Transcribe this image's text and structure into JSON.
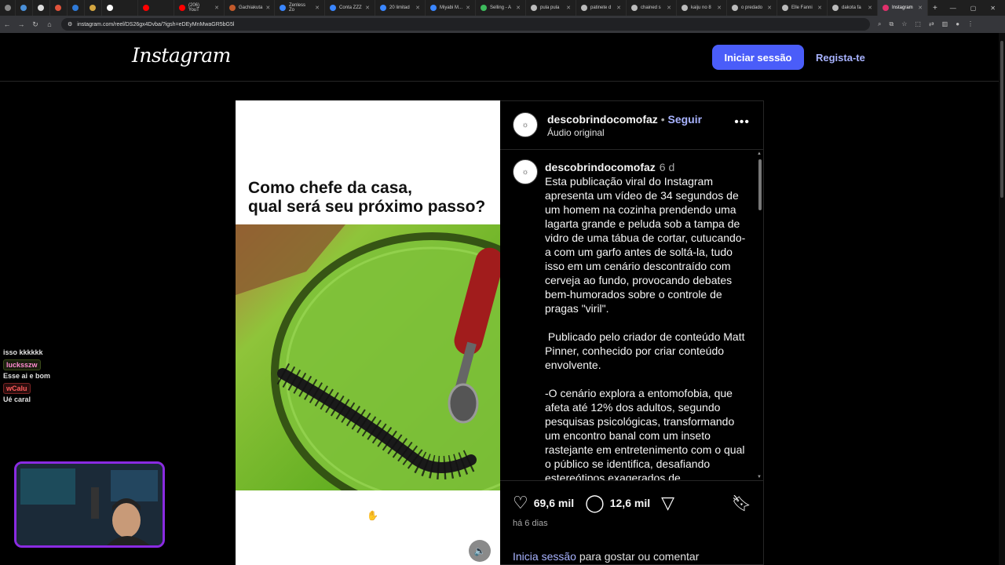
{
  "browser": {
    "tabs": [
      {
        "label": ""
      },
      {
        "label": ""
      },
      {
        "label": ""
      },
      {
        "label": ""
      },
      {
        "label": ""
      },
      {
        "label": ""
      },
      {
        "label": "(206) YouT"
      },
      {
        "label": "Gachiakuta"
      },
      {
        "label": "Zenless Zo"
      },
      {
        "label": "Conta ZZZ"
      },
      {
        "label": "20 limitad"
      },
      {
        "label": "Miyabi M..."
      },
      {
        "label": "Selling - A"
      },
      {
        "label": "pula pula"
      },
      {
        "label": "patinete d"
      },
      {
        "label": "chained s"
      },
      {
        "label": "kaiju no 8"
      },
      {
        "label": "o predado"
      },
      {
        "label": "Elle Fanni"
      },
      {
        "label": "dakota fa"
      },
      {
        "label": "Instagram"
      }
    ],
    "url": "instagram.com/reel/DS26gx4Dvba/?igsh=eDEyMnMwaGR5bG5l",
    "window_controls": [
      "—",
      "▢",
      "✕"
    ]
  },
  "instagram": {
    "logo_text": "Instagram",
    "login_button": "Iniciar sessão",
    "signup_link": "Regista-te"
  },
  "reel": {
    "caption_line1": "Como chefe da casa,",
    "caption_line2": "qual será seu próximo passo?",
    "mute_icon": "speaker-icon"
  },
  "post": {
    "username": "descobrindocomofaz",
    "separator": "•",
    "follow_label": "Seguir",
    "audio_label": "Áudio original",
    "comment": {
      "username": "descobrindocomofaz",
      "time": "6 d",
      "paragraphs": [
        "Esta publicação viral do Instagram apresenta um vídeo de 34 segundos de um homem na cozinha prendendo uma lagarta grande e peluda sob a tampa de vidro de uma tábua de cortar, cutucando-a com um garfo antes de soltá-la, tudo isso em um cenário descontraído com cerveja ao fundo, provocando debates bem-humorados sobre o controle de pragas \"viril\".",
        " Publicado pelo criador de conteúdo Matt Pinner, conhecido por criar conteúdo envolvente.",
        "-O cenário explora a entomofobia, que afeta até 12% dos adultos, segundo pesquisas psicológicas, transformando um encontro banal com um inseto rastejante em entretenimento com o qual o público se identifica, desafiando estereótipos exagerados de"
      ]
    },
    "likes": "69,6 mil",
    "comments_count": "12,6 mil",
    "posted": "há 6 dias",
    "login_prompt_link": "Inicia sessão",
    "login_prompt_rest": " para gostar ou comentar"
  },
  "stream_chat": {
    "messages": [
      {
        "user": "",
        "text": "isso kkkkkk"
      },
      {
        "user": "lucksszw",
        "text": "Esse ai e bom"
      },
      {
        "user": "wCalu",
        "text": "Ué caral"
      }
    ]
  }
}
